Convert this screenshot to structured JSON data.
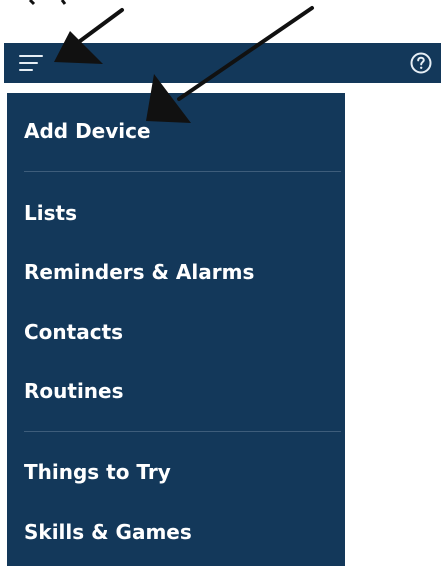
{
  "colors": {
    "bar_bg": "#13385a",
    "divider": "#3e5d7b",
    "text": "#ffffff",
    "annotation_arrow": "#111111"
  },
  "header": {
    "menu_icon": "hamburger-menu-icon",
    "help_icon": "help-circle-icon"
  },
  "drawer": {
    "items": [
      {
        "label": "Add Device"
      },
      {
        "label": "Lists"
      },
      {
        "label": "Reminders & Alarms"
      },
      {
        "label": "Contacts"
      },
      {
        "label": "Routines"
      },
      {
        "label": "Things to Try"
      },
      {
        "label": "Skills & Games"
      }
    ]
  }
}
